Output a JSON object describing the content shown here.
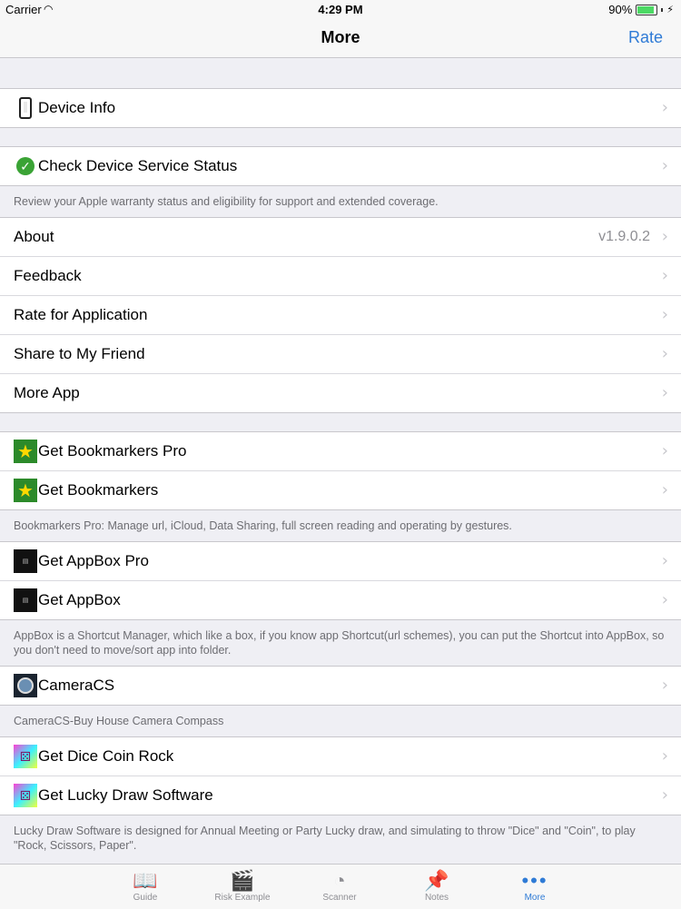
{
  "status": {
    "carrier": "Carrier",
    "time": "4:29 PM",
    "battery": "90%"
  },
  "nav": {
    "title": "More",
    "right": "Rate"
  },
  "sections": {
    "device_info": "Device Info",
    "check_status": "Check Device Service Status",
    "check_note": "Review your Apple warranty status and eligibility for support and extended coverage.",
    "about": "About",
    "about_version": "v1.9.0.2",
    "feedback": "Feedback",
    "rate_app": "Rate for Application",
    "share": "Share to My Friend",
    "more_app": "More App",
    "bookmarkers_pro": "Get Bookmarkers Pro",
    "bookmarkers": "Get Bookmarkers",
    "bookmarkers_note": "Bookmarkers Pro: Manage url, iCloud, Data Sharing, full screen reading and operating by gestures.",
    "appbox_pro": "Get AppBox Pro",
    "appbox": "Get AppBox",
    "appbox_note": "AppBox is a Shortcut Manager, which like a box, if you know app Shortcut(url schemes), you can put the Shortcut into AppBox, so you don't need to move/sort app into folder.",
    "cameracs": "CameraCS",
    "cameracs_note": "CameraCS-Buy House Camera Compass",
    "dice": "Get Dice Coin Rock",
    "lucky": "Get Lucky Draw Software",
    "lucky_note": "Lucky Draw Software is designed for Annual Meeting or Party Lucky draw, and simulating to throw \"Dice\" and \"Coin\", to play \"Rock, Scissors, Paper\"."
  },
  "tabs": [
    {
      "label": "Guide",
      "icon": "book-icon"
    },
    {
      "label": "Risk Example",
      "icon": "clapperboard-icon"
    },
    {
      "label": "Scanner",
      "icon": "scanner-icon"
    },
    {
      "label": "Notes",
      "icon": "pin-icon"
    },
    {
      "label": "More",
      "icon": "more-icon"
    }
  ],
  "colors": {
    "accent": "#2f7bd6",
    "background": "#efeff4",
    "check_green": "#3aa335"
  }
}
